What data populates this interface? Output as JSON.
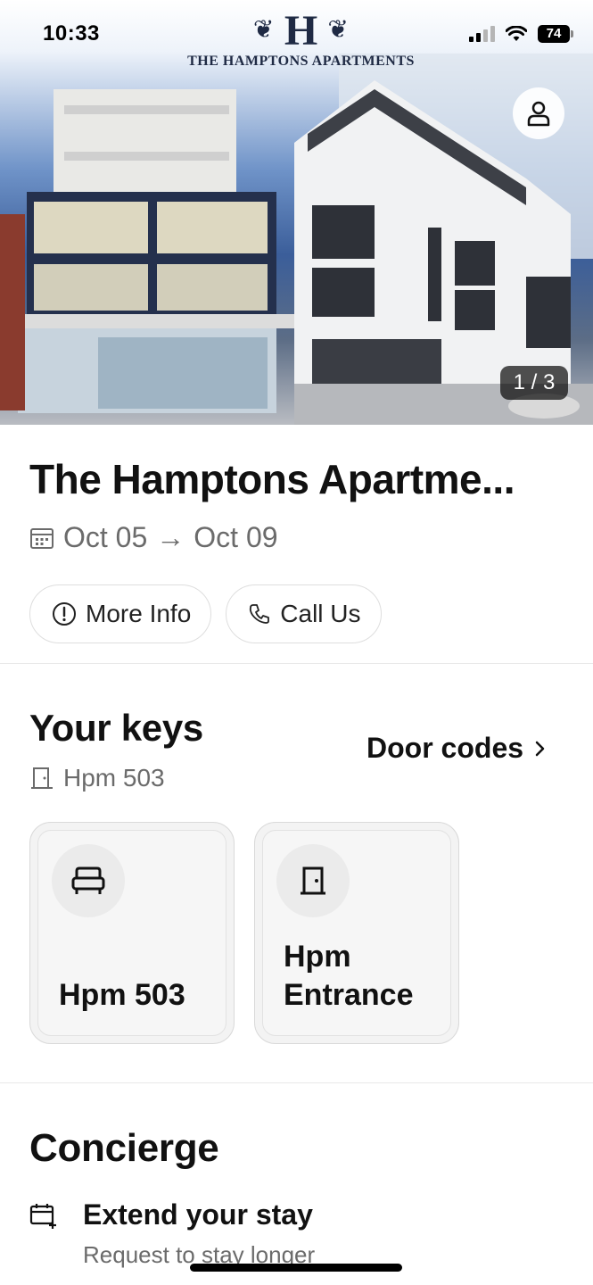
{
  "status_bar": {
    "time": "10:33",
    "battery": "74"
  },
  "hero": {
    "logo_letter": "H",
    "logo_text": "THE HAMPTONS APARTMENTS",
    "counter": "1 / 3",
    "profile_icon": "person-icon"
  },
  "property": {
    "title": "The Hamptons Apartme...",
    "check_in": "Oct 05",
    "arrow": "→",
    "check_out": "Oct 09",
    "actions": [
      {
        "label": "More Info",
        "icon": "info-icon"
      },
      {
        "label": "Call Us",
        "icon": "phone-icon"
      }
    ]
  },
  "keys": {
    "title": "Your keys",
    "door_codes_label": "Door codes",
    "unit": "Hpm 503",
    "cards": [
      {
        "label": "Hpm 503",
        "icon": "bed-icon"
      },
      {
        "label_line1": "Hpm",
        "label_line2": "Entrance",
        "icon": "door-icon"
      }
    ]
  },
  "concierge": {
    "title": "Concierge",
    "items": [
      {
        "title": "Extend your stay",
        "subtitle": "Request to stay longer",
        "icon": "calendar-plus-icon"
      }
    ]
  },
  "colors": {
    "text": "#111111",
    "muted": "#6b6b6b",
    "border": "#dedede",
    "logo_navy": "#1f2a44"
  }
}
